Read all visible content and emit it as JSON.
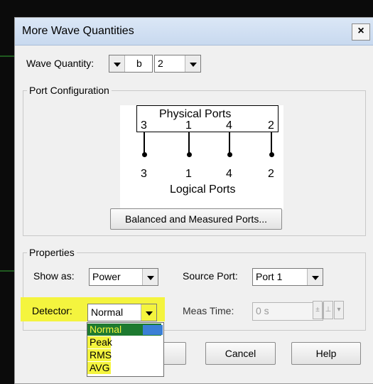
{
  "dialog": {
    "title": "More Wave Quantities",
    "close_symbol": "×"
  },
  "wave_quantity": {
    "label": "Wave Quantity:",
    "letter_value": "b",
    "number_value": "2"
  },
  "port_configuration": {
    "title": "Port Configuration",
    "physical_label": "Physical Ports",
    "logical_label": "Logical Ports",
    "physical_ports": [
      "3",
      "1",
      "4",
      "2"
    ],
    "logical_ports": [
      "3",
      "1",
      "4",
      "2"
    ],
    "balanced_button": "Balanced and Measured Ports..."
  },
  "properties": {
    "title": "Properties",
    "show_as_label": "Show as:",
    "show_as_value": "Power",
    "source_port_label": "Source Port:",
    "source_port_value": "Port 1",
    "detector_label": "Detector:",
    "detector_value": "Normal",
    "meas_time_label": "Meas Time:",
    "meas_time_value": "0 s"
  },
  "detector_dropdown": {
    "options": [
      "Normal",
      "Peak",
      "RMS",
      "AVG"
    ],
    "selected": "Normal"
  },
  "buttons": {
    "cancel": "Cancel",
    "help": "Help"
  },
  "colors": {
    "highlight": "#f4f43e",
    "selection": "#1e7a30",
    "title_bar": "#c8d9ef"
  }
}
